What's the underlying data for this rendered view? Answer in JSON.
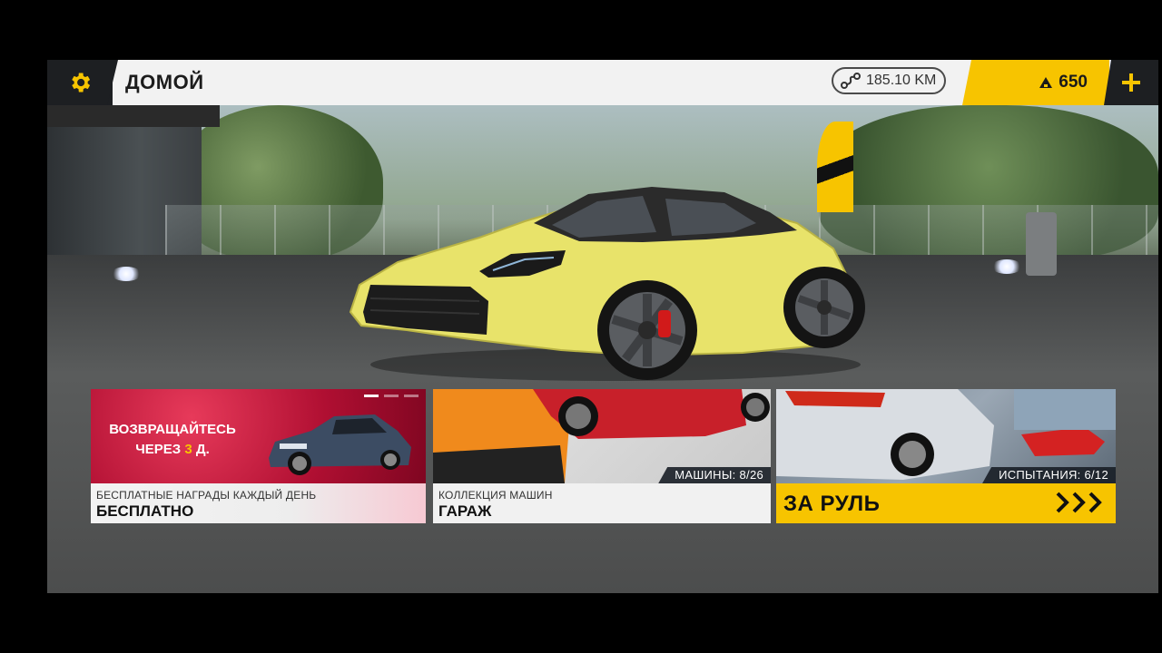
{
  "topbar": {
    "settings_icon": "gear-icon",
    "title": "ДОМОЙ",
    "distance": "185.10 KM",
    "distance_icon": "route-icon",
    "currency_icon": "gold-pile-icon",
    "currency_value": "650",
    "add_icon": "plus-icon"
  },
  "cards": {
    "daily": {
      "promo_line1": "ВОЗВРАЩАЙТЕСЬ",
      "promo_line2_prefix": "ЧЕРЕЗ",
      "promo_days": "3",
      "promo_line2_suffix": "Д.",
      "subtitle": "БЕСПЛАТНЫЕ НАГРАДЫ КАЖДЫЙ ДЕНЬ",
      "title": "БЕСПЛАТНО"
    },
    "garage": {
      "badge": "МАШИНЫ: 8/26",
      "subtitle": "КОЛЛЕКЦИЯ МАШИН",
      "title": "ГАРАЖ"
    },
    "drive": {
      "badge": "ИСПЫТАНИЯ: 6/12",
      "title": "ЗА РУЛЬ",
      "arrows_icon": "triple-chevron-right-icon"
    }
  },
  "colors": {
    "accent": "#f7c400",
    "dark": "#1d1f22",
    "promo_red": "#b00f32",
    "car_yellow": "#e8e36a"
  }
}
